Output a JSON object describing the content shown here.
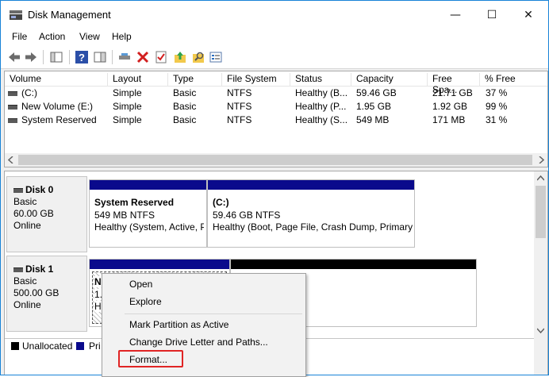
{
  "window": {
    "title": "Disk Management",
    "controls": {
      "minimize": "—",
      "maximize": "☐",
      "close": "✕"
    }
  },
  "menu": [
    "File",
    "Action",
    "View",
    "Help"
  ],
  "toolbar_icons": [
    "back-arrow-icon",
    "forward-arrow-icon",
    "console-tree-icon",
    "help-icon",
    "action-pane-icon",
    "connect-icon",
    "delete-icon",
    "checklist-icon",
    "open-folder-icon",
    "search-folder-icon",
    "properties-icon"
  ],
  "volume_list": {
    "columns": [
      "Volume",
      "Layout",
      "Type",
      "File System",
      "Status",
      "Capacity",
      "Free Spa...",
      "% Free"
    ],
    "rows": [
      [
        "(C:)",
        "Simple",
        "Basic",
        "NTFS",
        "Healthy (B...",
        "59.46 GB",
        "21.71 GB",
        "37 %"
      ],
      [
        "New Volume (E:)",
        "Simple",
        "Basic",
        "NTFS",
        "Healthy (P...",
        "1.95 GB",
        "1.92 GB",
        "99 %"
      ],
      [
        "System Reserved",
        "Simple",
        "Basic",
        "NTFS",
        "Healthy (S...",
        "549 MB",
        "171 MB",
        "31 %"
      ]
    ]
  },
  "disks": [
    {
      "name": "Disk 0",
      "type": "Basic",
      "size": "60.00 GB",
      "status": "Online",
      "partitions": [
        {
          "name": "System Reserved",
          "detail": "549 MB NTFS",
          "status": "Healthy (System, Active, Pri"
        },
        {
          "name": "(C:)",
          "detail": "59.46 GB NTFS",
          "status": "Healthy (Boot, Page File, Crash Dump, Primary"
        }
      ]
    },
    {
      "name": "Disk 1",
      "type": "Basic",
      "size": "500.00 GB",
      "status": "Online",
      "partitions": [
        {
          "name": "N",
          "detail": "1.",
          "status": "H"
        },
        {
          "name": "",
          "detail": "",
          "status": ""
        }
      ]
    }
  ],
  "legend": [
    {
      "label": "Unallocated",
      "color": "#000000"
    },
    {
      "label": "Pri",
      "color": "#0a0a8c"
    }
  ],
  "context_menu": {
    "items": [
      "Open",
      "Explore",
      "Mark Partition as Active",
      "Change Drive Letter and Paths...",
      "Format..."
    ],
    "highlighted": "Format..."
  },
  "colors": {
    "primary_partition": "#0a0a8c",
    "unallocated": "#000000",
    "highlight_box": "#e02424",
    "window_border": "#1883d7"
  }
}
